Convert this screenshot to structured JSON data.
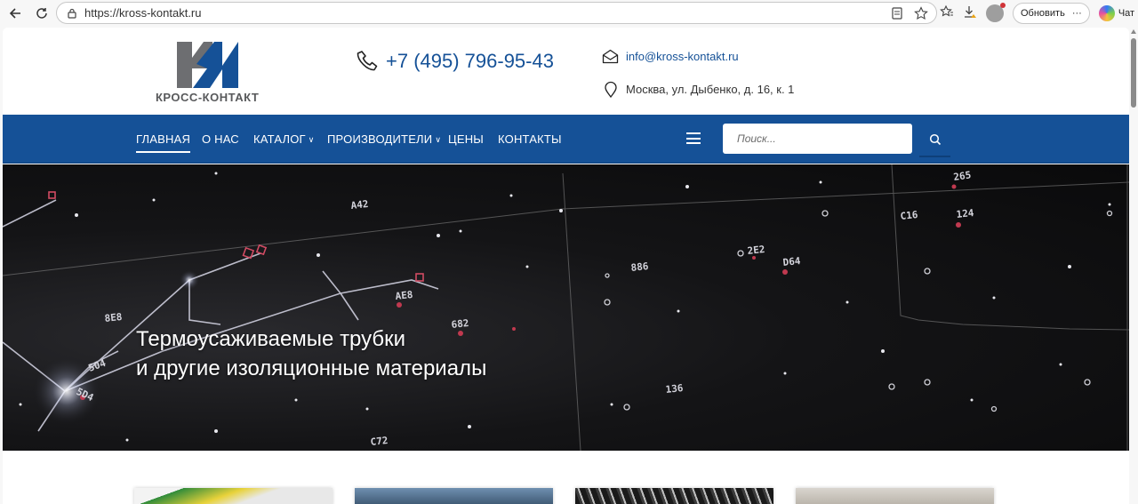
{
  "browser": {
    "url": "https://kross-kontakt.ru",
    "update_label": "Обновить",
    "more_label": "···",
    "chat_label": "Чат"
  },
  "header": {
    "logo_text": "КРОСС-КОНТАКТ",
    "phone": "+7 (495) 796-95-43",
    "email": "info@kross-kontakt.ru",
    "address": "Москва, ул. Дыбенко, д. 16, к. 1"
  },
  "nav": {
    "items": [
      {
        "label": "ГЛАВНАЯ",
        "active": true
      },
      {
        "label": "О НАС"
      },
      {
        "label": "КАТАЛОГ",
        "dropdown": true
      },
      {
        "label": "ПРОИЗВОДИТЕЛИ",
        "dropdown": true
      },
      {
        "label": "ЦЕНЫ"
      },
      {
        "label": "КОНТАКТЫ"
      }
    ],
    "search_placeholder": "Поиск..."
  },
  "hero": {
    "title_line1": "Термоусаживаемые трубки",
    "title_line2": "и другие изоляционные материалы",
    "map_labels": [
      "A42",
      "265",
      "C16",
      "124",
      "2E2",
      "D64",
      "886",
      "AE8",
      "682",
      "8E8",
      "504",
      "5D4",
      "136",
      "C72"
    ]
  },
  "colors": {
    "brand_blue": "#155197",
    "logo_gray": "#58595b"
  }
}
